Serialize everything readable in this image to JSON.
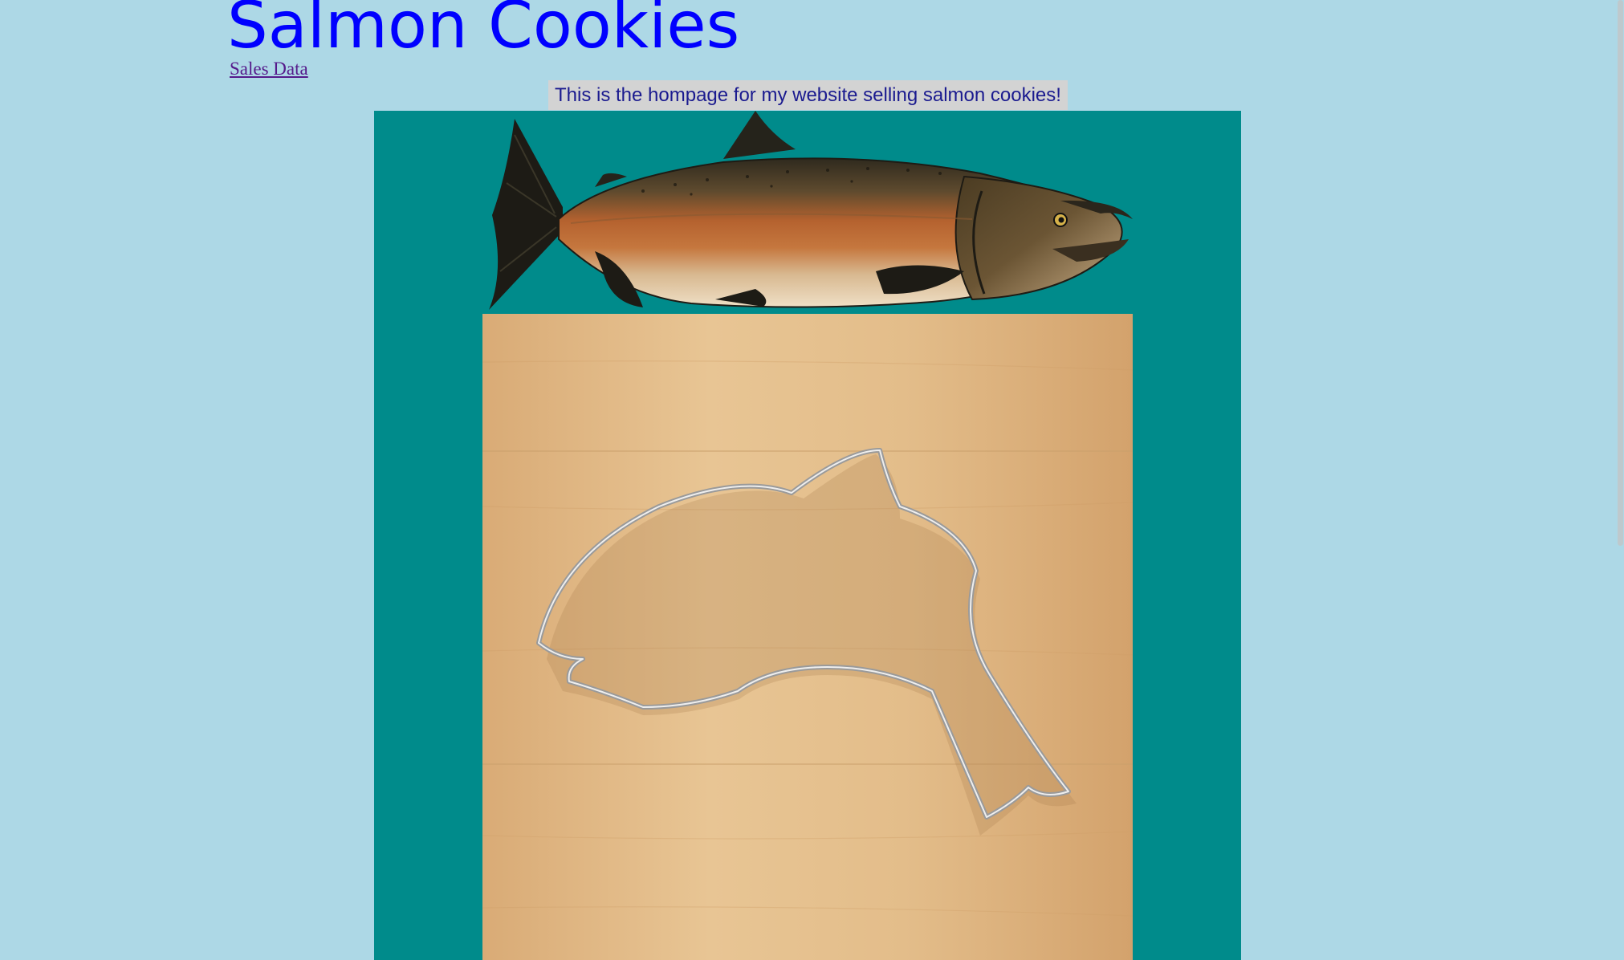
{
  "header": {
    "title": "Salmon Cookies",
    "nav_link": "Sales Data"
  },
  "main": {
    "intro": "This is the hompage for my website selling salmon cookies!"
  },
  "colors": {
    "page_background": "#add8e6",
    "title": "#0000ff",
    "gallery_background": "#008b8b",
    "intro_background": "#d3d3d3"
  }
}
